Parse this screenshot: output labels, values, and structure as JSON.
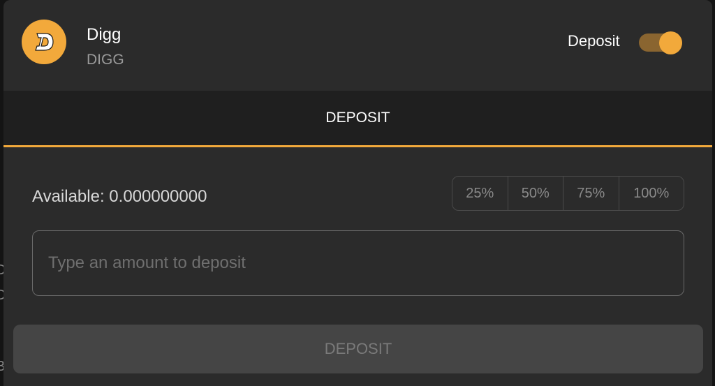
{
  "backdrop": {
    "glyphs": [
      "D",
      "D",
      "B"
    ]
  },
  "token": {
    "name": "Digg",
    "symbol": "DIGG",
    "logo_icon": "digg-coin-icon",
    "logo_color": "#f2a93b"
  },
  "mode_toggle": {
    "label": "Deposit",
    "on": true,
    "accent": "#f2a93b"
  },
  "tabs": [
    {
      "label": "DEPOSIT",
      "active": true
    }
  ],
  "balance": {
    "text": "Available: 0.000000000"
  },
  "percent_buttons": [
    "25%",
    "50%",
    "75%",
    "100%"
  ],
  "amount_input": {
    "value": "",
    "placeholder": "Type an amount to deposit"
  },
  "submit": {
    "label": "DEPOSIT",
    "enabled": false
  }
}
